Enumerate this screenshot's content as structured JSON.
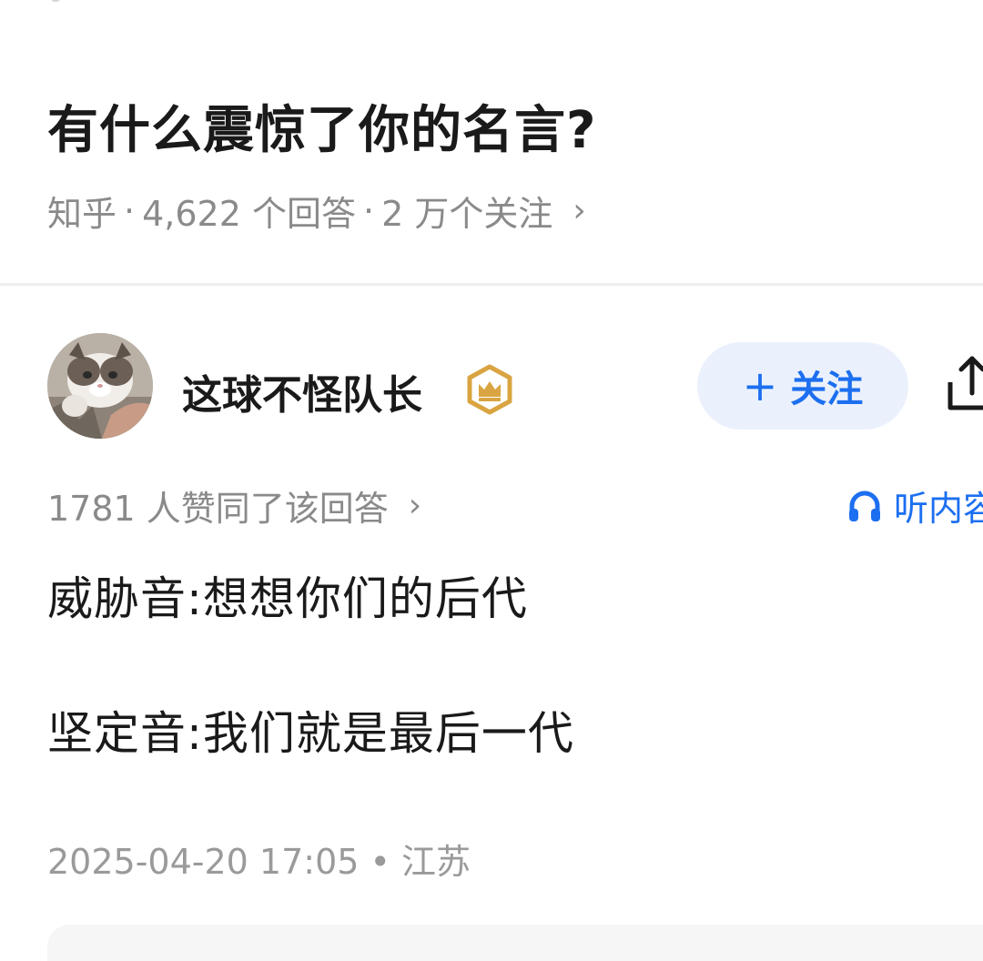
{
  "question": {
    "title": "有什么震惊了你的名言?",
    "source": "知乎",
    "answers": "4,622 个回答",
    "followers": "2 万个关注",
    "separator": "·",
    "chevron": "›"
  },
  "answer": {
    "author": {
      "name": "这球不怪队长",
      "avatar_icon": "cat-avatar",
      "badge_icon": "crown-badge-icon"
    },
    "follow_button": {
      "plus": "+",
      "label": "关注"
    },
    "likes_text": "1781 人赞同了该回答",
    "listen_label": "听内容",
    "content_lines": [
      "威胁音:想想你们的后代",
      "坚定音:我们就是最后一代"
    ],
    "timestamp": "2025-04-20 17:05 • 江苏"
  },
  "colors": {
    "accent": "#1c6ff0",
    "follow_bg": "#ebf1fc",
    "meta_gray": "#8a8a8a",
    "badge_gold": "#d9a441"
  }
}
